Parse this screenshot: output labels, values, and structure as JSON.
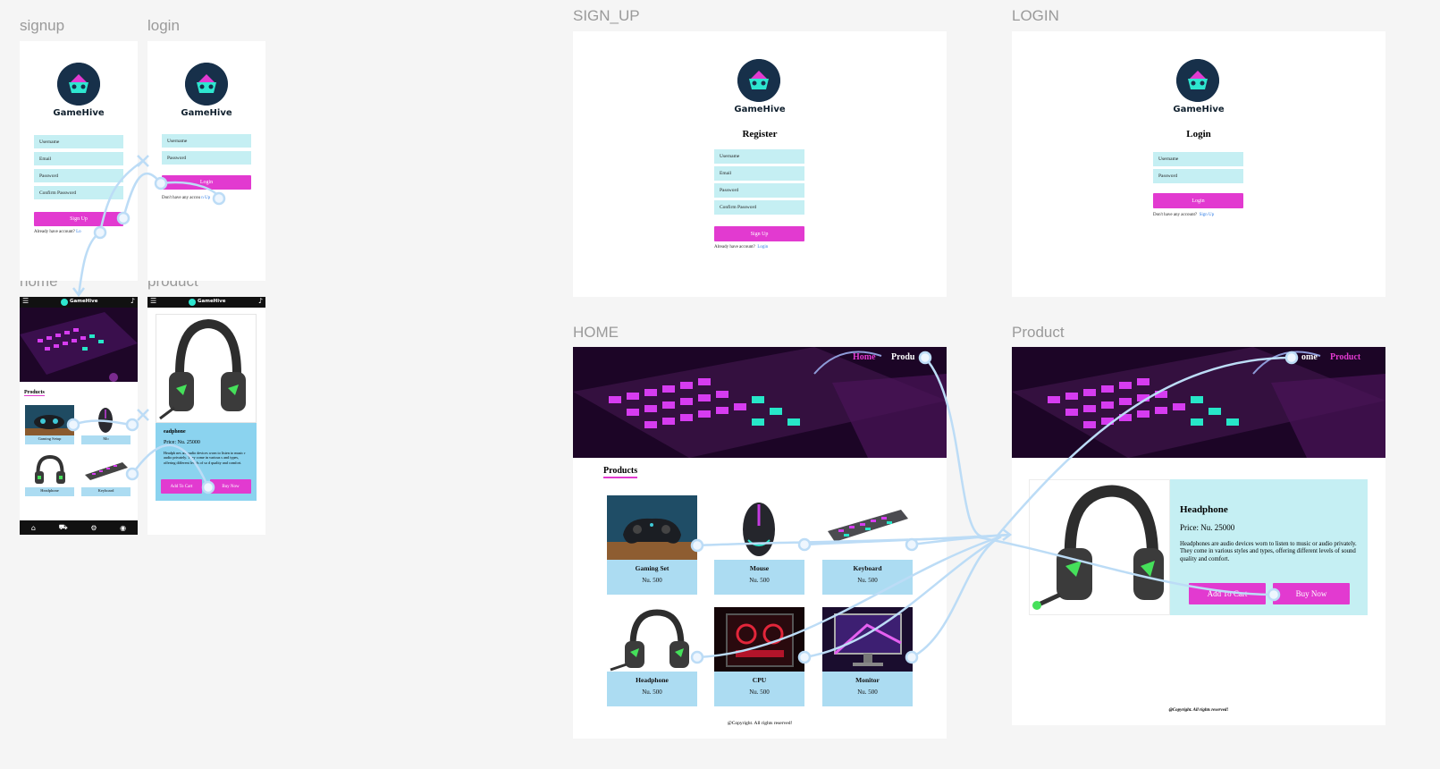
{
  "canvas": {
    "frames": {
      "signup_mobile": "signup",
      "login_mobile": "login",
      "home_mobile": "home",
      "product_mobile": "product",
      "signup_desktop": "SIGN_UP",
      "login_desktop": "LOGIN",
      "home_desktop": "HOME",
      "product_desktop": "Product"
    }
  },
  "brand": {
    "name": "GameHive",
    "accent": "#e23ad0",
    "field_color": "#c5eff3",
    "card_color": "#acdcf2",
    "link_color": "#2c7be5"
  },
  "signup": {
    "title": "Register",
    "fields": [
      "Username",
      "Email",
      "Password",
      "Confirm Password"
    ],
    "button": "Sign Up",
    "footer_text": "Already have account?",
    "footer_link": "Login",
    "mobile_footer_link": "Lo"
  },
  "login": {
    "title": "Login",
    "fields": [
      "Username",
      "Password"
    ],
    "button": "Login",
    "footer_text": "Don't have any account?",
    "footer_link": "Sign Up",
    "mobile_footer_text": "Don't have any accou",
    "mobile_footer_link": "n Up"
  },
  "home": {
    "nav": [
      "Home",
      "Product"
    ],
    "nav_partial": "Produ",
    "section_title": "Products",
    "products": [
      {
        "name": "Gaming Set",
        "price": "Nu. 500",
        "icon": "gamepad-image"
      },
      {
        "name": "Mouse",
        "price": "Nu. 500",
        "icon": "mouse-image"
      },
      {
        "name": "Keyboard",
        "price": "Nu. 500",
        "icon": "keyboard-image"
      },
      {
        "name": "Headphone",
        "price": "Nu. 500",
        "icon": "headphone-image"
      },
      {
        "name": "CPU",
        "price": "Nu. 500",
        "icon": "cpu-image"
      },
      {
        "name": "Monitor",
        "price": "Nu. 500",
        "icon": "monitor-image"
      }
    ],
    "mobile_products": [
      "Gaming Setup",
      "Mo",
      "Headphone",
      "Keyboard"
    ],
    "footer": "@Copyright. All rights reserved!"
  },
  "mobile_header": {
    "brand": "GameHive",
    "menu_icon": "menu-icon",
    "bell_icon": "bell-icon"
  },
  "mobile_tabbar": [
    "home-icon",
    "cart-icon",
    "settings-icon",
    "profile-icon"
  ],
  "product": {
    "nav": [
      "Home",
      "Product"
    ],
    "nav_partial": "ome",
    "name": "Headphone",
    "price": "Price: Nu. 25000",
    "description": "Headphones are audio devices worn to listen to music or audio privately. They come in various styles and types, offering different levels of sound quality and comfort.",
    "add_to_cart": "Add To Cart",
    "buy_now": "Buy Now",
    "footer": "@Copyright. All rights reserved!",
    "mobile_name": "eadphone",
    "mobile_price": "Price: Nu. 25000",
    "mobile_description": "Headph nes are audio devices worn to listen to music r audio privately. They come in various s and types, offering different levels of so d quality and comfort."
  }
}
